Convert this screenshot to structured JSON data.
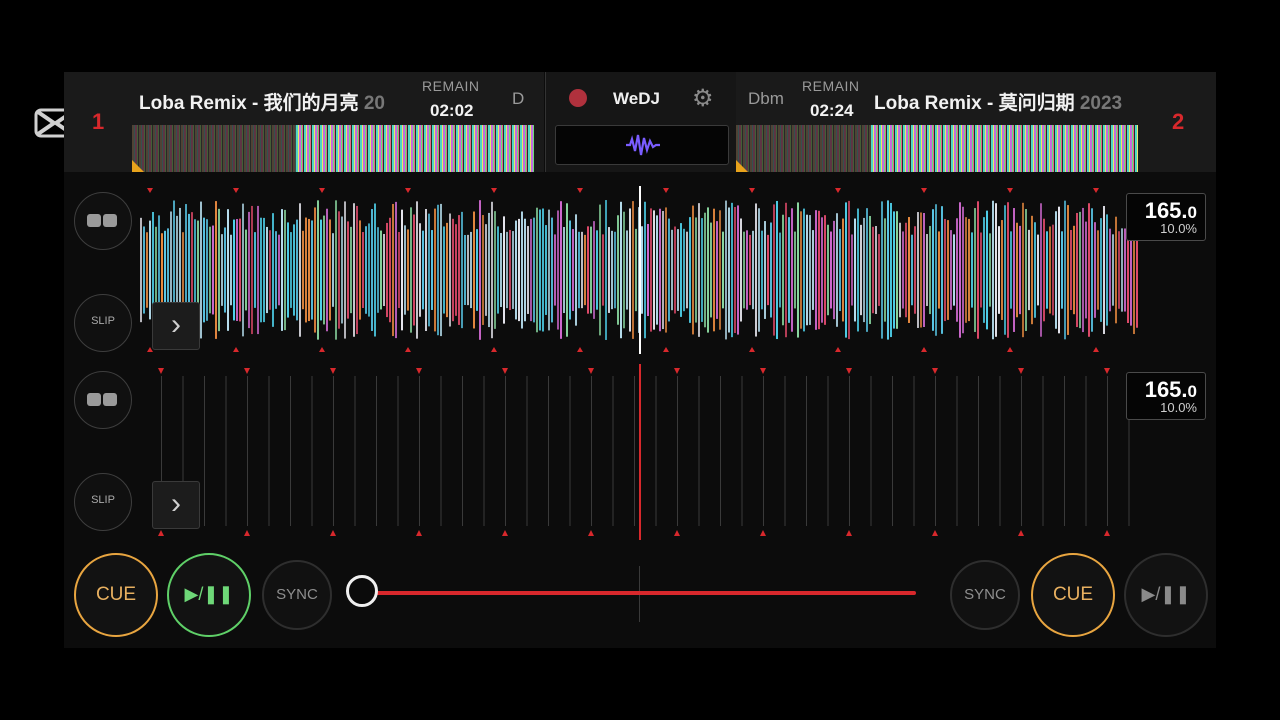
{
  "overlay": {
    "capcut_logo": "capcut-logo"
  },
  "deck1": {
    "number": "1",
    "title": "Loba Remix - 我们的月亮",
    "title_overflow": "20",
    "remain_label": "REMAIN",
    "remain": "02:02",
    "key": "D",
    "bpm": "165.",
    "bpm_decimal": "0",
    "pitch": "10.0%",
    "slip_label": "SLIP",
    "cue_label": "CUE",
    "play_label": "▶/❚❚",
    "sync_label": "SYNC",
    "play_progress": 0.5
  },
  "deck2": {
    "number": "2",
    "title": "Loba Remix - 莫问归期",
    "title_overflow": "2023",
    "remain_label": "REMAIN",
    "remain": "02:24",
    "key": "Dbm",
    "bpm": "165.",
    "bpm_decimal": "0",
    "pitch": "10.0%",
    "slip_label": "SLIP",
    "cue_label": "CUE",
    "play_label": "▶/❚❚",
    "sync_label": "SYNC",
    "play_progress": 0.33
  },
  "center": {
    "brand": "WeDJ",
    "record_icon": "record-icon",
    "settings_icon": "gear-icon",
    "fx_icon": "waveform-icon"
  },
  "crossfader": {
    "position": 0.0
  },
  "colors": {
    "accent_red": "#d8282c",
    "cue_orange": "#e8a540",
    "play_green": "#5fd068",
    "background": "#0c0c0c"
  }
}
